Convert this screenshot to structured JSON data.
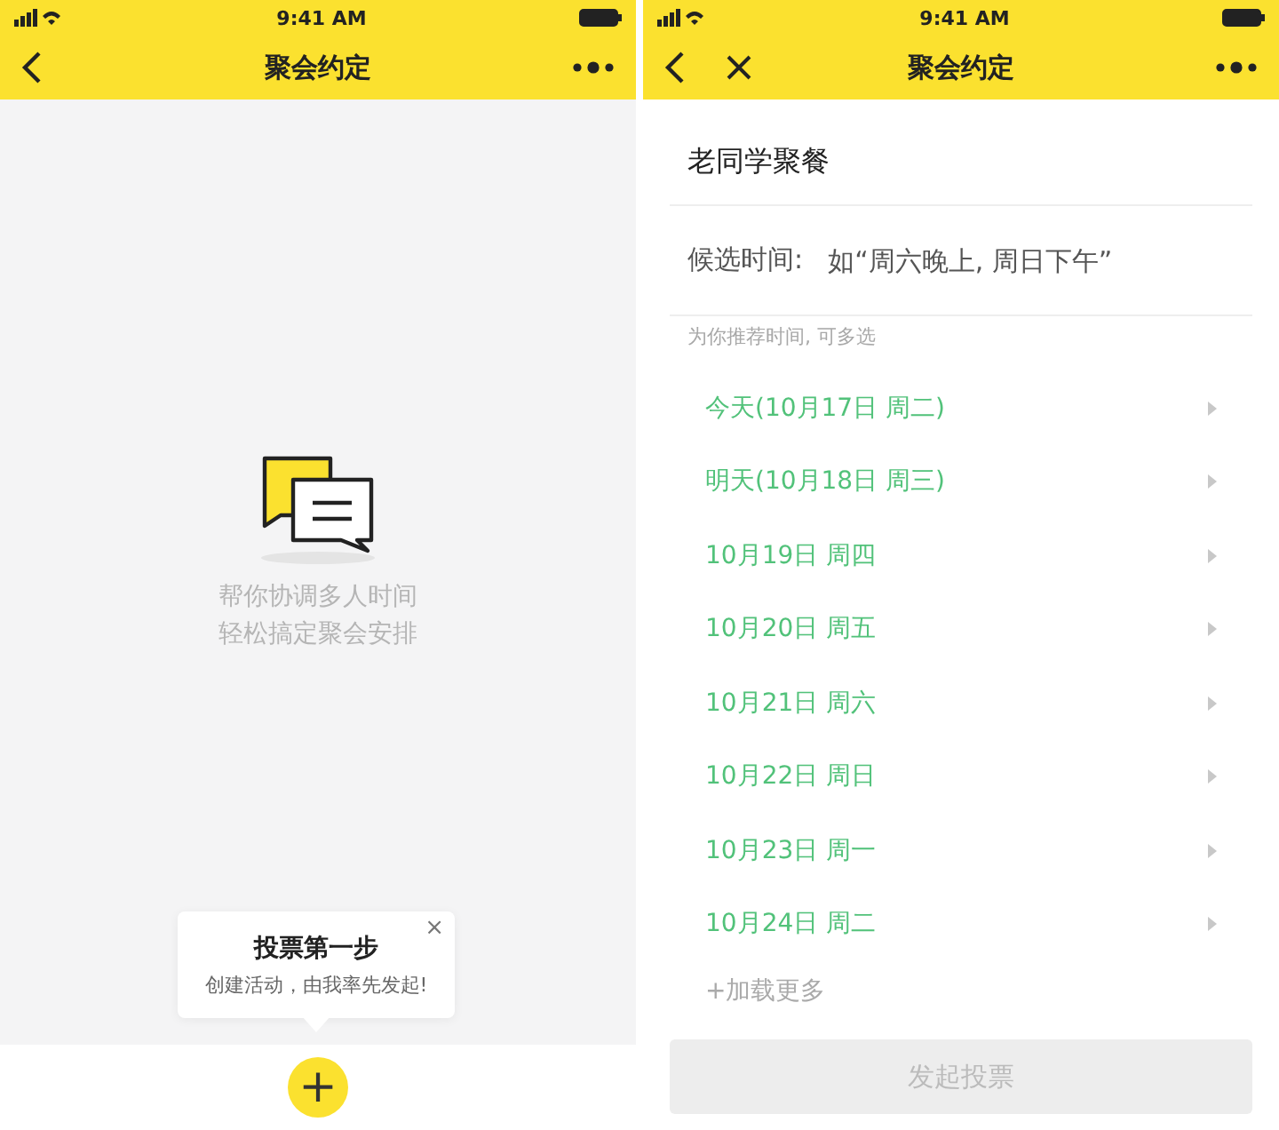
{
  "screens": [
    {
      "status_bar": {
        "time": "9:41 AM"
      },
      "nav": {
        "title": "聚会约定",
        "close": false
      },
      "empty_state": {
        "lines": [
          "帮你协调多人时间",
          "轻松搞定聚会安排"
        ]
      },
      "tooltip": {
        "title": "投票第一步",
        "text": "创建活动，由我率先发起!",
        "close": "×"
      },
      "fab": {
        "label": "+"
      }
    },
    {
      "status_bar": {
        "time": "9:41 AM"
      },
      "nav": {
        "title": "聚会约定",
        "close": true
      },
      "form": {
        "title_value": "老同学聚餐",
        "candidate_label": "候选时间:",
        "candidate_placeholder": "如“周六晚上, 周日下午”",
        "hint": "为你推荐时间, 可多选",
        "dates": [
          "今天(10月17日 周二)",
          "明天(10月18日 周三)",
          "10月19日 周四",
          "10月20日 周五",
          "10月21日 周六",
          "10月22日 周日",
          "10月23日 周一",
          "10月24日 周二"
        ],
        "load_more": "+加载更多",
        "submit": {
          "label": "发起投票",
          "disabled": true
        }
      }
    }
  ]
}
